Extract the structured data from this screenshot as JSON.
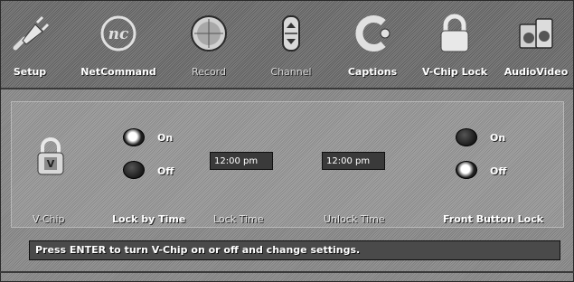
{
  "menu": {
    "items": [
      {
        "label": "Setup",
        "icon": "plug-icon"
      },
      {
        "label": "NetCommand",
        "icon": "netcommand-logo-icon"
      },
      {
        "label": "Record",
        "icon": "record-disc-icon"
      },
      {
        "label": "Channel",
        "icon": "channel-updown-icon"
      },
      {
        "label": "Captions",
        "icon": "captions-icon"
      },
      {
        "label": "V-Chip Lock",
        "icon": "padlock-icon"
      },
      {
        "label": "AudioVideo",
        "icon": "audio-video-icon"
      }
    ],
    "selected": "V-Chip Lock"
  },
  "vchip": {
    "label": "V-Chip",
    "icon": "padlock-v-icon"
  },
  "lock_by_time": {
    "label": "Lock by Time",
    "on_label": "On",
    "off_label": "Off",
    "selected": "On"
  },
  "lock_time": {
    "label": "Lock Time",
    "value": "12:00 pm"
  },
  "unlock_time": {
    "label": "Unlock Time",
    "value": "12:00 pm"
  },
  "front_button_lock": {
    "label": "Front Button Lock",
    "on_label": "On",
    "off_label": "Off",
    "selected": "Off"
  },
  "status": {
    "text": "Press ENTER to turn V-Chip on or off and change settings."
  }
}
